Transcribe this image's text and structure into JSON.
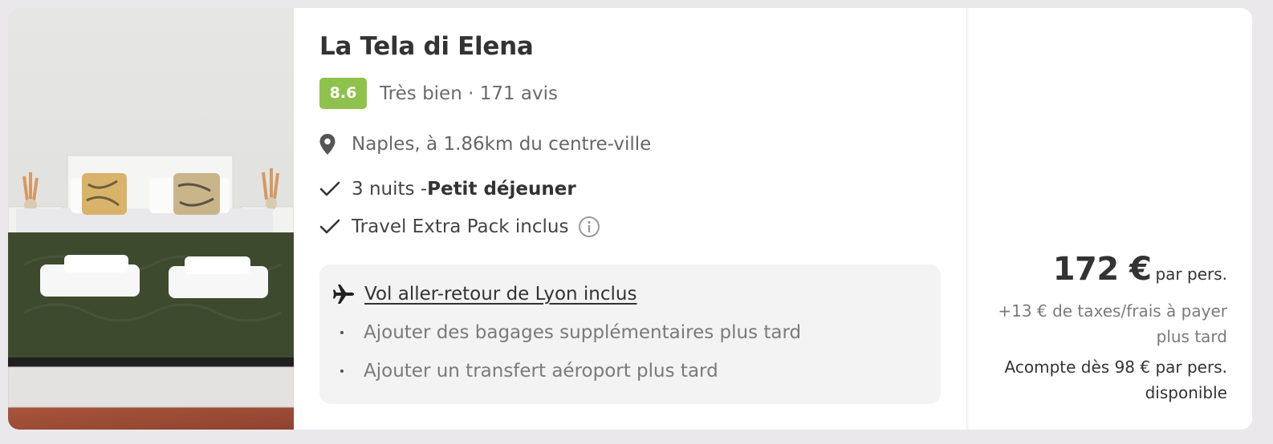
{
  "hotel": {
    "name": "La Tela di Elena",
    "rating": {
      "score": "8.6",
      "label": "Très bien · 171 avis",
      "badge_color": "#8fc24d"
    },
    "photo_icon": "hotel-room-photo",
    "location": {
      "icon": "location-pin-icon",
      "text": "Naples, à 1.86km du centre-ville"
    },
    "nights": {
      "icon": "check-icon",
      "prefix": "3 nuits - ",
      "board": "Petit déjeuner"
    },
    "pack": {
      "icon": "check-icon",
      "text": "Travel Extra Pack inclus",
      "info_icon": "info-icon"
    },
    "flight": {
      "icon": "airplane-icon",
      "title": "Vol aller-retour de Lyon inclus",
      "options": [
        "Ajouter des bagages supplémentaires plus tard",
        "Ajouter un transfert aéroport plus tard"
      ]
    }
  },
  "price": {
    "amount": "172 €",
    "unit": "par pers.",
    "taxes": "+13 € de taxes/frais à payer plus tard",
    "deposit": "Acompte dès 98 € par pers. disponible"
  }
}
